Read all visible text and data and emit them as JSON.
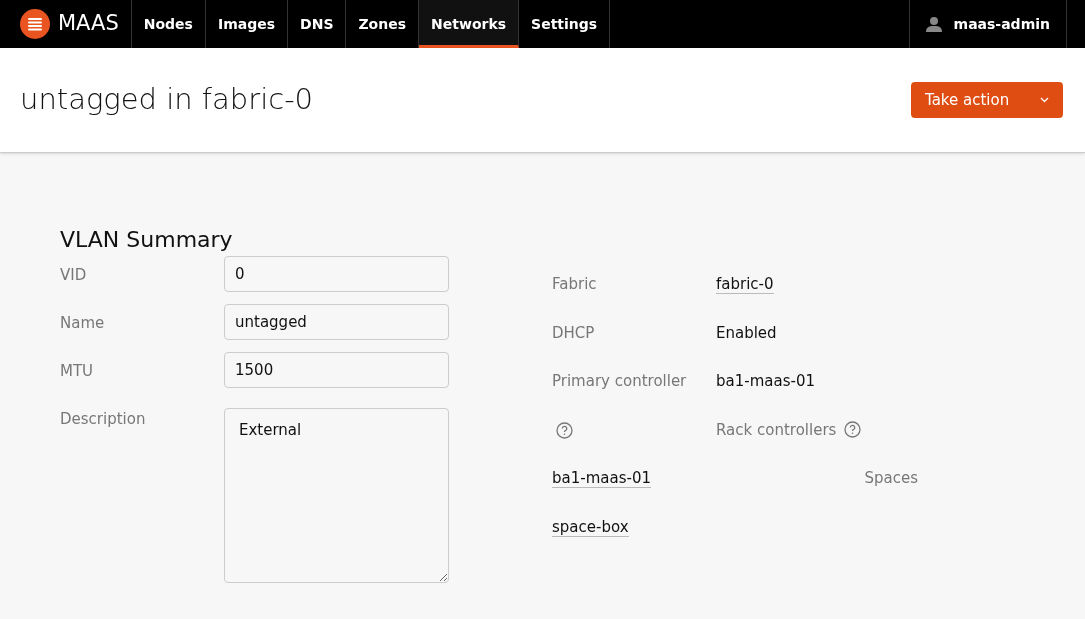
{
  "nav": {
    "brand": "MAAS",
    "items": [
      {
        "label": "Nodes",
        "selected": false
      },
      {
        "label": "Images",
        "selected": false
      },
      {
        "label": "DNS",
        "selected": false
      },
      {
        "label": "Zones",
        "selected": false
      },
      {
        "label": "Networks",
        "selected": true
      },
      {
        "label": "Settings",
        "selected": false
      }
    ],
    "user": "maas-admin"
  },
  "header": {
    "title": "untagged in fabric-0",
    "action_button": "Take action"
  },
  "summary": {
    "title": "VLAN Summary",
    "fields": [
      {
        "label": "VID",
        "value": "0",
        "kind": "input"
      },
      {
        "label": "Name",
        "value": "untagged",
        "kind": "input"
      },
      {
        "label": "MTU",
        "value": "1500",
        "kind": "input"
      },
      {
        "label": "Description",
        "value": "External",
        "kind": "textarea"
      }
    ],
    "fabric": {
      "label": "Fabric",
      "value": "fabric-0"
    },
    "dhcp": {
      "label": "DHCP",
      "value": "Enabled"
    },
    "primary_controller": {
      "label": "Primary controller",
      "value": "ba1-maas-01"
    },
    "rack_controllers": {
      "label": "Rack controllers",
      "values": [
        "ba1-maas-01"
      ]
    },
    "spaces": {
      "label": "Spaces",
      "values": [
        "space-box"
      ]
    }
  }
}
